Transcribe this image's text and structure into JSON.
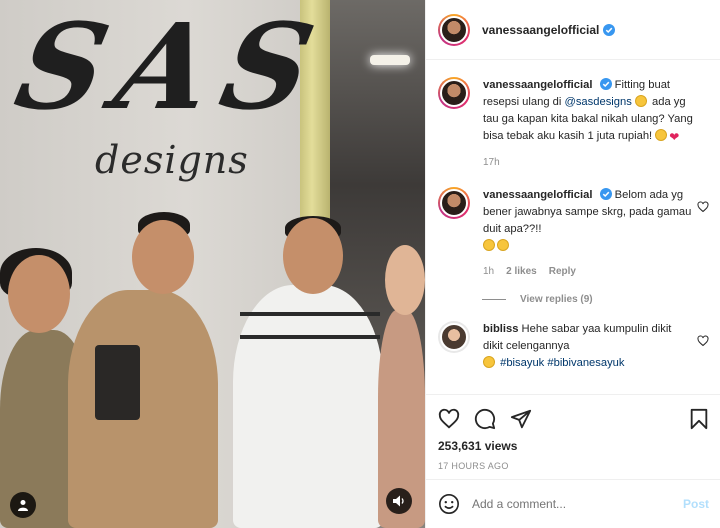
{
  "media": {
    "sign_main": "SAS",
    "sign_sub": "designs"
  },
  "post": {
    "author": "vanessaangelofficial"
  },
  "caption": {
    "username": "vanessaangelofficial",
    "text_before": "Fitting buat resepsi ulang di ",
    "mention": "@sasdesigns",
    "text_after": " ada yg tau ga kapan kita bakal nikah ulang? Yang bisa tebak aku kasih 1 juta rupiah!",
    "time": "17h"
  },
  "comments": [
    {
      "username": "vanessaangelofficial",
      "text": "Belom ada yg bener jawabnya sampe skrg, pada gamau duit apa??!!",
      "time": "1h",
      "likes": "2 likes",
      "reply": "Reply",
      "view_replies": "View replies (9)"
    },
    {
      "username": "bibliss",
      "text": "Hehe sabar yaa kumpulin dikit dikit celengannya",
      "tags": "#bisayuk #bibivanesayuk"
    }
  ],
  "stats": {
    "views": "253,631 views",
    "timestamp": "17 HOURS AGO"
  },
  "add_comment": {
    "placeholder": "Add a comment...",
    "post_label": "Post"
  },
  "colors": {
    "verified": "#3897f0",
    "link": "#00376b",
    "post_disabled": "#b2dffc"
  }
}
